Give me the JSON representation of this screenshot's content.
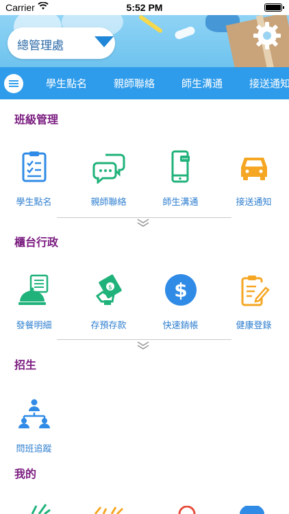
{
  "status_bar": {
    "carrier": "Carrier",
    "time": "5:52 PM"
  },
  "header": {
    "selector_value": "總管理處"
  },
  "nav": {
    "tabs": [
      "學生點名",
      "親師聯絡",
      "師生溝通",
      "接送通知"
    ]
  },
  "sections": [
    {
      "title": "班級管理",
      "items": [
        {
          "label": "學生點名",
          "icon": "clipboard-checklist-icon"
        },
        {
          "label": "親師聯絡",
          "icon": "chat-bubbles-icon"
        },
        {
          "label": "師生溝通",
          "icon": "phone-message-icon"
        },
        {
          "label": "接送通知",
          "icon": "car-icon"
        }
      ]
    },
    {
      "title": "櫃台行政",
      "items": [
        {
          "label": "發餐明細",
          "icon": "meal-cloche-icon"
        },
        {
          "label": "存預存款",
          "icon": "cash-hand-icon"
        },
        {
          "label": "快速銷帳",
          "icon": "dollar-coin-icon"
        },
        {
          "label": "健康登錄",
          "icon": "clipboard-pen-icon"
        }
      ]
    },
    {
      "title": "招生",
      "items": [
        {
          "label": "問班追蹤",
          "icon": "people-network-icon"
        }
      ]
    },
    {
      "title": "我的",
      "items": []
    }
  ],
  "colors": {
    "nav": "#2f9ceb",
    "section_title": "#7b1d80",
    "item_label": "#2f7fd0",
    "green": "#1fb27a",
    "blue": "#2f8be6",
    "orange": "#f5a623"
  }
}
